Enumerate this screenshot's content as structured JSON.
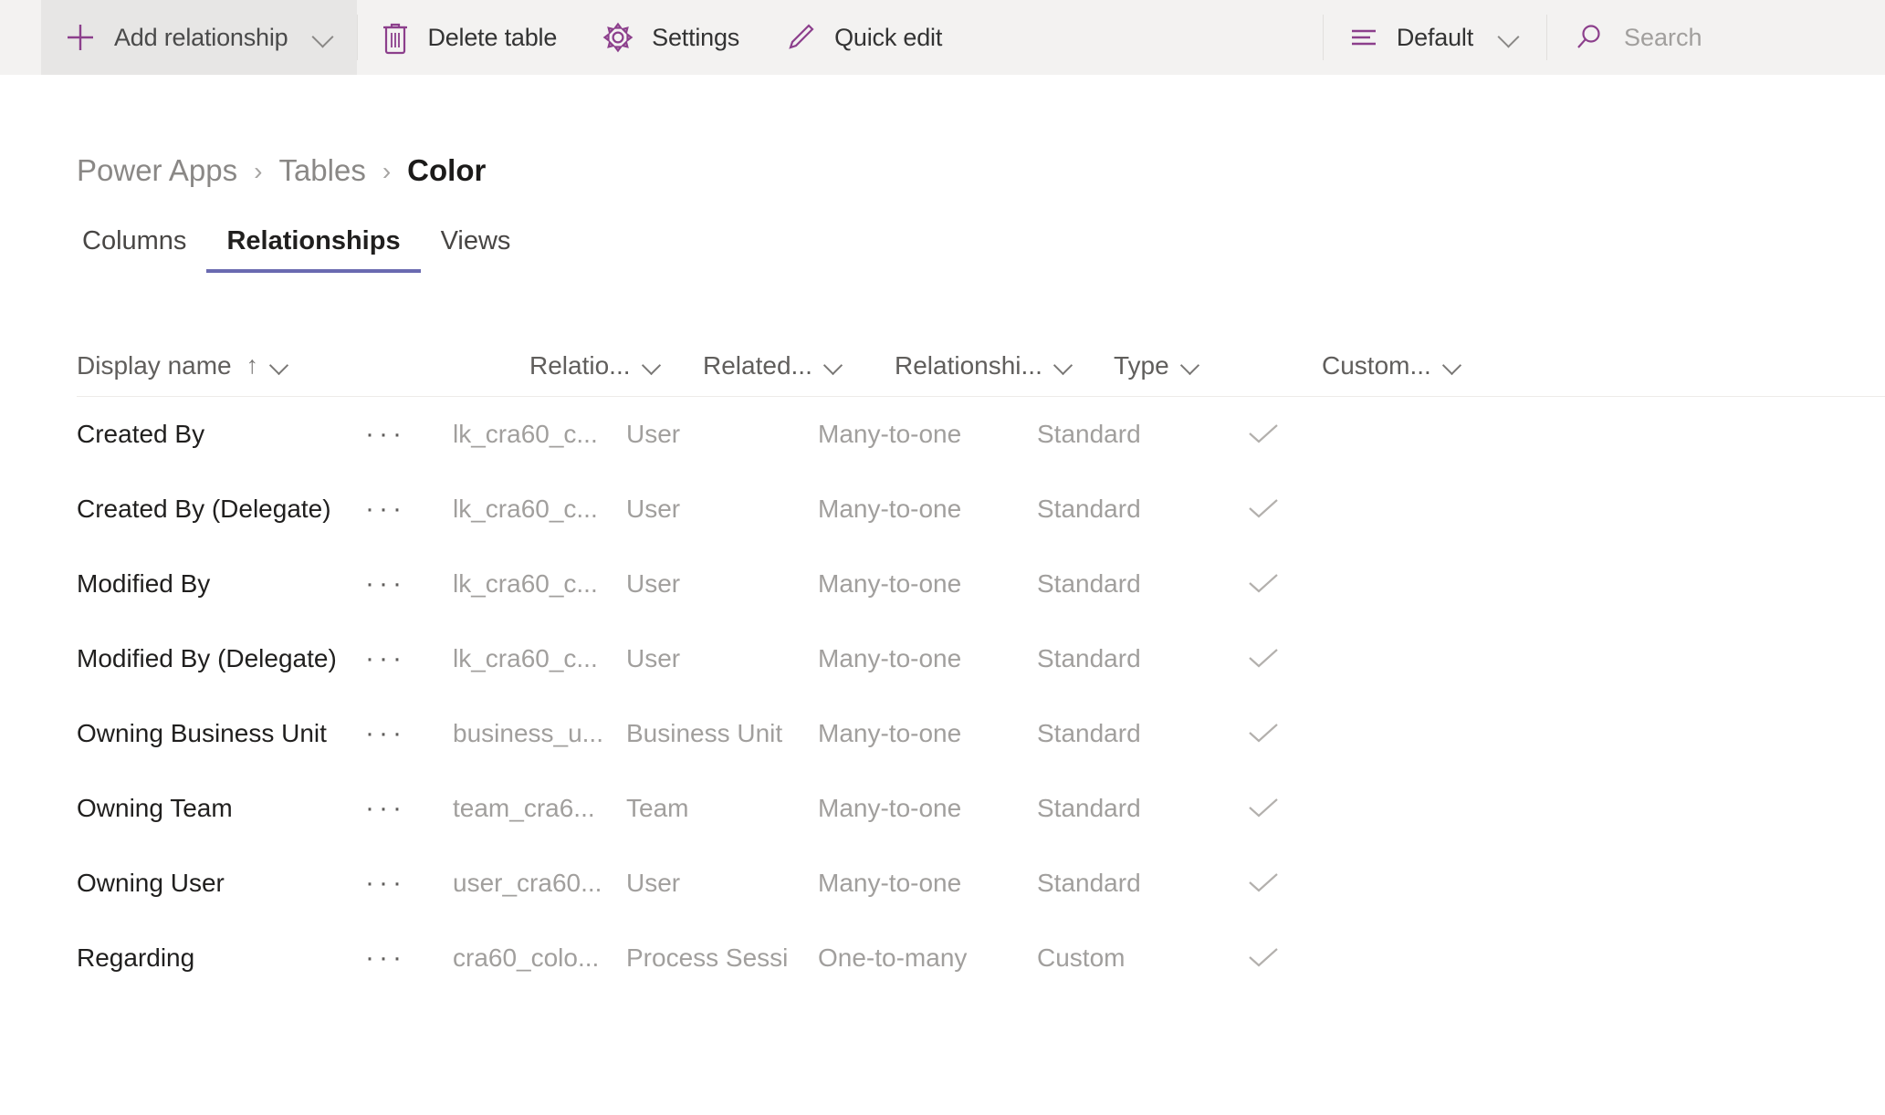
{
  "toolbar": {
    "add_relationship": {
      "label": "Add relationship",
      "icon": "plus-icon",
      "has_chevron": true,
      "hovered": true
    },
    "delete_table": {
      "label": "Delete table",
      "icon": "trash-icon"
    },
    "settings": {
      "label": "Settings",
      "icon": "gear-icon"
    },
    "quick_edit": {
      "label": "Quick edit",
      "icon": "pencil-icon"
    },
    "view_picker": {
      "label": "Default",
      "icon": "list-lines-icon",
      "has_chevron": true
    },
    "search": {
      "placeholder": "Search",
      "icon": "search-icon"
    },
    "accent_color": "#8c3f8c",
    "background": "#f3f2f1",
    "hover_background": "#e7e6e5"
  },
  "breadcrumb": {
    "items": [
      {
        "label": "Power Apps",
        "current": false
      },
      {
        "label": "Tables",
        "current": false
      },
      {
        "label": "Color",
        "current": true
      }
    ],
    "separator": "›"
  },
  "tabs": {
    "items": [
      {
        "label": "Columns",
        "active": false
      },
      {
        "label": "Relationships",
        "active": true
      },
      {
        "label": "Views",
        "active": false
      }
    ],
    "active_underline_color": "#6a6ab0"
  },
  "grid": {
    "sort": {
      "column": "Display name",
      "direction": "ascending",
      "glyph": "↑"
    },
    "columns": [
      {
        "label": "Display name",
        "sorted": true
      },
      {
        "label": "Relatio...",
        "sorted": false
      },
      {
        "label": "Related...",
        "sorted": false
      },
      {
        "label": "Relationshi...",
        "sorted": false
      },
      {
        "label": "Type",
        "sorted": false
      },
      {
        "label": "Custom...",
        "sorted": false
      }
    ],
    "row_menu_glyph": "···",
    "rows": [
      {
        "display_name": "Created By",
        "relationship_name": "lk_cra60_c...",
        "related_table": "User",
        "relationship_type": "Many-to-one",
        "type": "Standard",
        "customizable": true
      },
      {
        "display_name": "Created By (Delegate)",
        "relationship_name": "lk_cra60_c...",
        "related_table": "User",
        "relationship_type": "Many-to-one",
        "type": "Standard",
        "customizable": true
      },
      {
        "display_name": "Modified By",
        "relationship_name": "lk_cra60_c...",
        "related_table": "User",
        "relationship_type": "Many-to-one",
        "type": "Standard",
        "customizable": true
      },
      {
        "display_name": "Modified By (Delegate)",
        "relationship_name": "lk_cra60_c...",
        "related_table": "User",
        "relationship_type": "Many-to-one",
        "type": "Standard",
        "customizable": true
      },
      {
        "display_name": "Owning Business Unit",
        "relationship_name": "business_u...",
        "related_table": "Business Unit",
        "relationship_type": "Many-to-one",
        "type": "Standard",
        "customizable": true
      },
      {
        "display_name": "Owning Team",
        "relationship_name": "team_cra6...",
        "related_table": "Team",
        "relationship_type": "Many-to-one",
        "type": "Standard",
        "customizable": true
      },
      {
        "display_name": "Owning User",
        "relationship_name": "user_cra60...",
        "related_table": "User",
        "relationship_type": "Many-to-one",
        "type": "Standard",
        "customizable": true
      },
      {
        "display_name": "Regarding",
        "relationship_name": "cra60_colo...",
        "related_table": "Process Sessi",
        "relationship_type": "One-to-many",
        "type": "Custom",
        "customizable": true
      }
    ]
  }
}
